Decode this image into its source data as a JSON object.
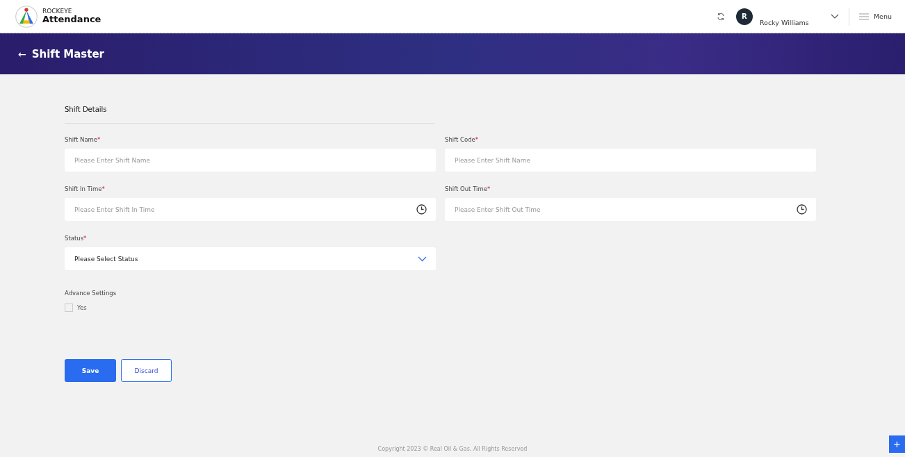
{
  "header": {
    "brand_top": "ROCKEYE",
    "brand_name": "Attendance",
    "user_initial": "R",
    "user_name": "Rocky Williams",
    "menu_label": "Menu"
  },
  "banner": {
    "back_glyph": "←",
    "title": "Shift Master"
  },
  "form": {
    "section_title": "Shift Details",
    "fields": [
      {
        "kind": "text",
        "label": "Shift Name",
        "required_mark": "*",
        "placeholder": "Please Enter Shift Name"
      },
      {
        "kind": "text",
        "label": "Shift Code",
        "required_mark": "*",
        "placeholder": "Please Enter Shift Name"
      },
      {
        "kind": "time",
        "label": "Shift In Time",
        "required_mark": "*",
        "placeholder": "Please Enter Shift In Time"
      },
      {
        "kind": "time",
        "label": "Shift Out Time",
        "required_mark": "*",
        "placeholder": "Please Enter Shift Out Time"
      },
      {
        "kind": "select",
        "label": "Status",
        "required_mark": "*",
        "value": "Please Select Status"
      }
    ],
    "advance": {
      "label": "Advance Settings",
      "option": "Yes",
      "checked": false
    },
    "buttons": [
      {
        "kind": "primary",
        "label": "Save"
      },
      {
        "kind": "outline",
        "label": "Discard"
      }
    ]
  },
  "footer": {
    "copyright": "Copyright 2023 © Real Oil & Gas. All Rights Reserved"
  },
  "fab": {
    "glyph": "+"
  }
}
